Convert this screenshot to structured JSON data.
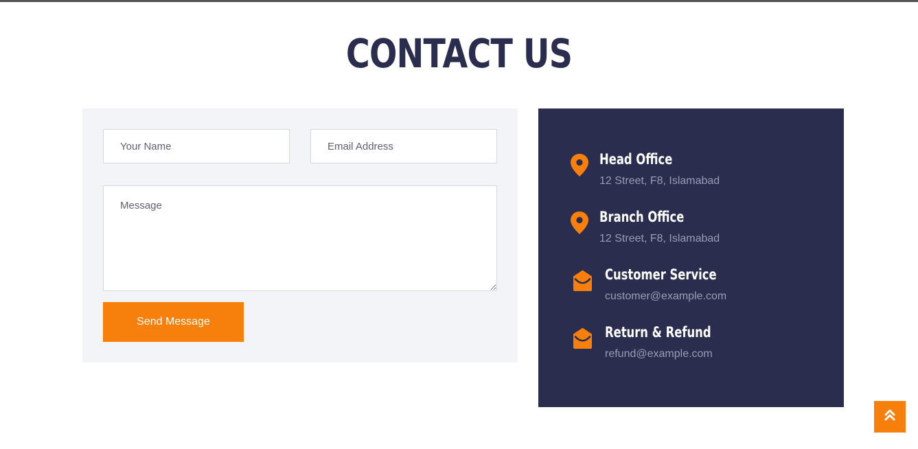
{
  "page": {
    "title": "CONTACT US"
  },
  "form": {
    "name_placeholder": "Your Name",
    "email_placeholder": "Email Address",
    "message_placeholder": "Message",
    "submit_label": "Send Message"
  },
  "contact_info": [
    {
      "icon": "map-pin-icon",
      "title": "Head Office",
      "text": "12 Street, F8, Islamabad"
    },
    {
      "icon": "map-pin-icon",
      "title": "Branch Office",
      "text": "12 Street, F8, Islamabad"
    },
    {
      "icon": "envelope-open-icon",
      "title": "Customer Service",
      "text": "customer@example.com"
    },
    {
      "icon": "envelope-open-icon",
      "title": "Return & Refund",
      "text": "refund@example.com"
    }
  ],
  "scroll_top": {
    "icon": "double-chevron-up-icon"
  },
  "colors": {
    "accent": "#f77f0b",
    "navy": "#2b2d4e",
    "panel_bg": "#f3f4f7",
    "muted_text": "#9a9db4"
  }
}
